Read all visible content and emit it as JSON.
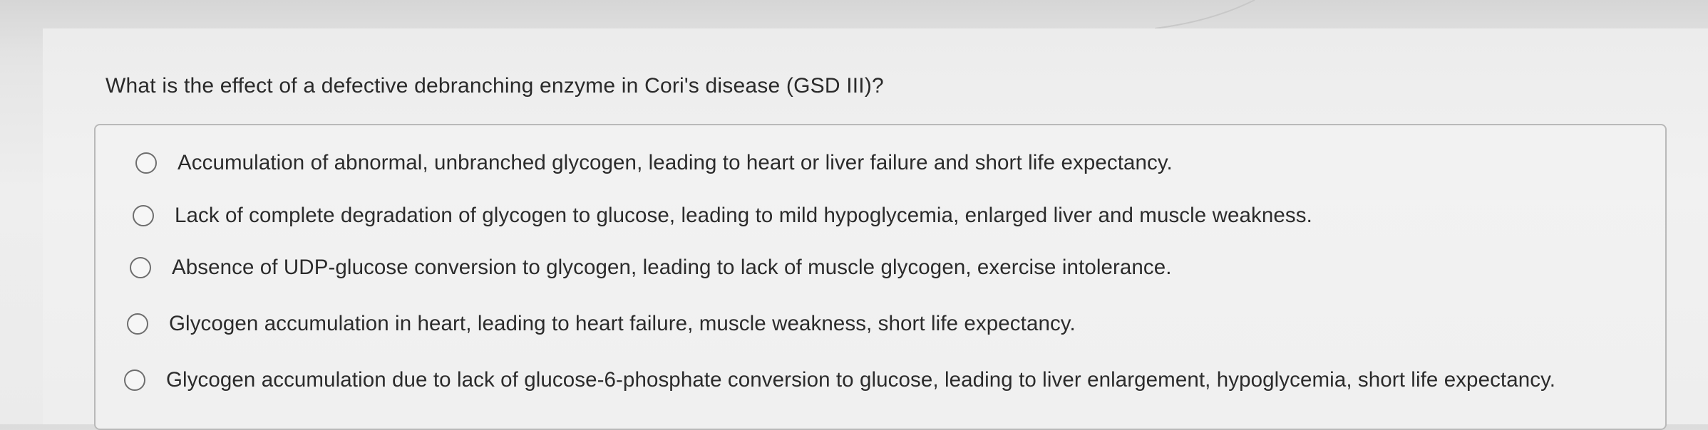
{
  "question": {
    "text": "What is the effect of a defective debranching enzyme in Cori's disease (GSD III)?"
  },
  "options": [
    {
      "label": "Accumulation of abnormal, unbranched glycogen, leading to heart or liver failure and short life expectancy."
    },
    {
      "label": "Lack of complete degradation of glycogen to glucose, leading to mild hypoglycemia, enlarged liver and muscle weakness."
    },
    {
      "label": "Absence of UDP-glucose conversion to glycogen, leading to lack of muscle glycogen, exercise intolerance."
    },
    {
      "label": "Glycogen accumulation in heart, leading to heart failure, muscle weakness, short life expectancy."
    },
    {
      "label": "Glycogen accumulation due to lack of glucose-6-phosphate conversion to glucose, leading to liver enlargement, hypoglycemia, short life expectancy."
    }
  ],
  "colors": {
    "text": "#2b2b2b",
    "border": "#b9b9b9",
    "background": "#eeeeee"
  }
}
